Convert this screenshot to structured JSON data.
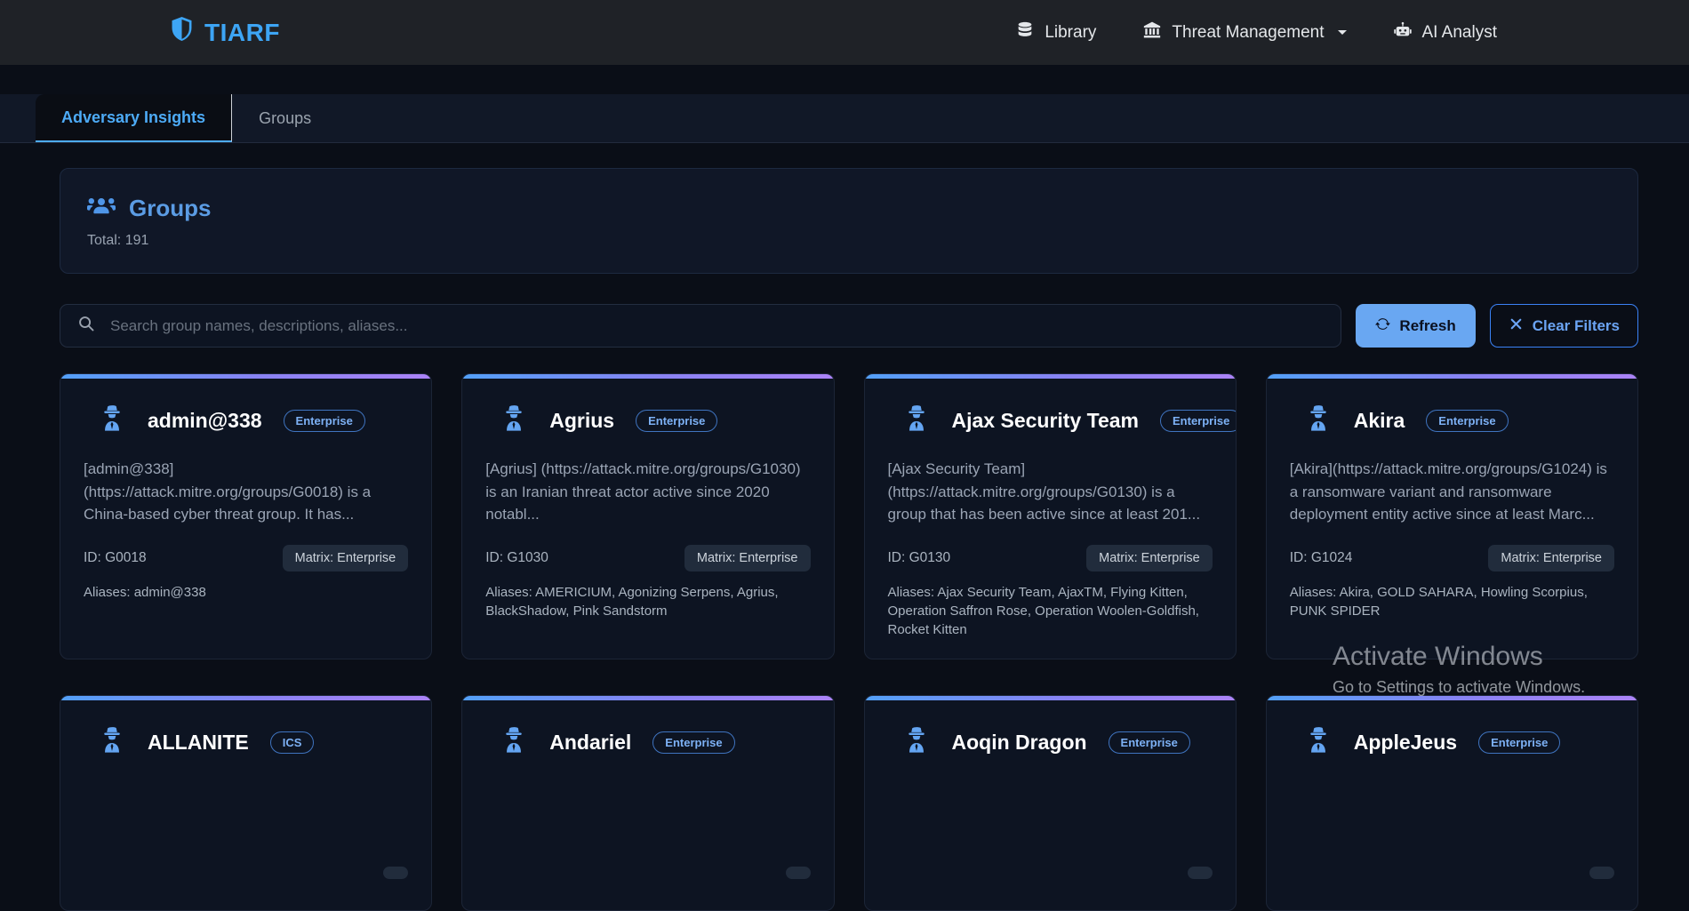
{
  "navbar": {
    "brand": "TIARF",
    "items": [
      {
        "label": "Library"
      },
      {
        "label": "Threat Management"
      },
      {
        "label": "AI Analyst"
      }
    ]
  },
  "tabs": [
    {
      "label": "Adversary Insights",
      "active": true
    },
    {
      "label": "Groups",
      "active": false
    }
  ],
  "groups_panel": {
    "title": "Groups",
    "total": "Total: 191"
  },
  "toolbar": {
    "search_placeholder": "Search group names, descriptions, aliases...",
    "refresh_label": "Refresh",
    "clear_filters_label": "Clear Filters"
  },
  "cards": [
    {
      "name": "admin@338",
      "badge": "Enterprise",
      "description": "[admin@338] (https://attack.mitre.org/groups/G0018) is a China-based cyber threat group. It has...",
      "id": "ID: G0018",
      "matrix": "Matrix: Enterprise",
      "aliases": "Aliases: admin@338"
    },
    {
      "name": "Agrius",
      "badge": "Enterprise",
      "description": "[Agrius] (https://attack.mitre.org/groups/G1030) is an Iranian threat actor active since 2020 notabl...",
      "id": "ID: G1030",
      "matrix": "Matrix: Enterprise",
      "aliases": "Aliases: AMERICIUM, Agonizing Serpens, Agrius, BlackShadow, Pink Sandstorm"
    },
    {
      "name": "Ajax Security Team",
      "badge": "Enterprise",
      "description": "[Ajax Security Team] (https://attack.mitre.org/groups/G0130) is a group that has been active since at least 201...",
      "id": "ID: G0130",
      "matrix": "Matrix: Enterprise",
      "aliases": "Aliases: Ajax Security Team, AjaxTM, Flying Kitten, Operation Saffron Rose, Operation Woolen-Goldfish, Rocket Kitten"
    },
    {
      "name": "Akira",
      "badge": "Enterprise",
      "description": "[Akira](https://attack.mitre.org/groups/G1024) is a ransomware variant and ransomware deployment entity active since at least Marc...",
      "id": "ID: G1024",
      "matrix": "Matrix: Enterprise",
      "aliases": "Aliases: Akira, GOLD SAHARA, Howling Scorpius, PUNK SPIDER"
    },
    {
      "name": "ALLANITE",
      "badge": "ICS",
      "partial": true
    },
    {
      "name": "Andariel",
      "badge": "Enterprise",
      "partial": true
    },
    {
      "name": "Aoqin Dragon",
      "badge": "Enterprise",
      "partial": true
    },
    {
      "name": "AppleJeus",
      "badge": "Enterprise",
      "partial": true
    }
  ],
  "watermark": {
    "line1": "Activate Windows",
    "line2": "Go to Settings to activate Windows."
  },
  "colors": {
    "accent": "#4dabf7",
    "brand_blue": "#3da5f5",
    "refresh_button": "#69a7f2",
    "card_gradient_start": "#53a0f8",
    "card_gradient_end": "#ab83f7",
    "navbar_bg": "#1f2227",
    "page_bg": "#0a0e17",
    "card_bg": "#0d1422"
  }
}
